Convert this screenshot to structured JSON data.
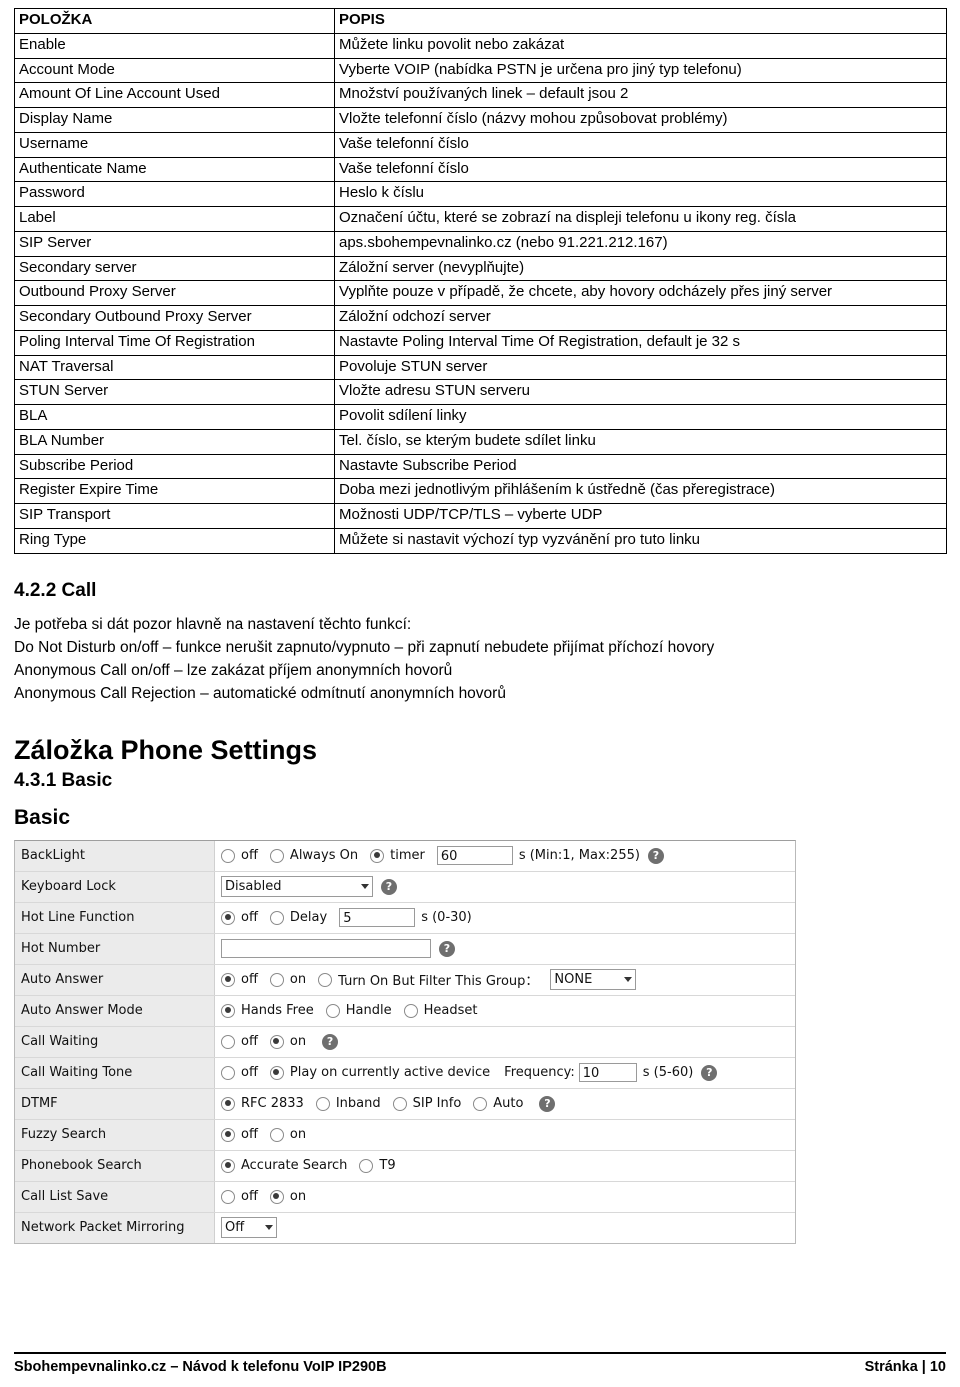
{
  "table": {
    "headers": [
      "POLOŽKA",
      "POPIS"
    ],
    "rows": [
      [
        "Enable",
        "Můžete linku povolit nebo zakázat"
      ],
      [
        "Account Mode",
        "Vyberte VOIP (nabídka PSTN je určena pro jiný typ telefonu)"
      ],
      [
        "Amount Of Line Account Used",
        "Množství používaných linek – default jsou 2"
      ],
      [
        "Display Name",
        "Vložte telefonní číslo (názvy mohou způsobovat problémy)"
      ],
      [
        "Username",
        "Vaše telefonní číslo"
      ],
      [
        "Authenticate Name",
        "Vaše telefonní číslo"
      ],
      [
        "Password",
        "Heslo k číslu"
      ],
      [
        "Label",
        "Označení účtu, které se zobrazí na displeji telefonu u ikony reg. čísla"
      ],
      [
        "SIP Server",
        "aps.sbohempevnalinko.cz  (nebo 91.221.212.167)"
      ],
      [
        "Secondary server",
        "Záložní server (nevyplňujte)"
      ],
      [
        "Outbound Proxy Server",
        "Vyplňte pouze v případě, že chcete, aby hovory odcházely přes jiný server"
      ],
      [
        "Secondary Outbound Proxy Server",
        "Záložní odchozí server"
      ],
      [
        "Poling Interval Time Of Registration",
        "Nastavte Poling Interval Time Of Registration, default je 32 s"
      ],
      [
        "NAT Traversal",
        "Povoluje STUN server"
      ],
      [
        "STUN Server",
        "Vložte adresu STUN serveru"
      ],
      [
        "BLA",
        "Povolit sdílení linky"
      ],
      [
        "BLA Number",
        "Tel. číslo, se kterým budete sdílet linku"
      ],
      [
        "Subscribe Period",
        "Nastavte Subscribe Period"
      ],
      [
        "Register Expire Time",
        "Doba mezi jednotlivým přihlášením k ústředně (čas přeregistrace)"
      ],
      [
        "SIP Transport",
        "Možnosti UDP/TCP/TLS – vyberte UDP"
      ],
      [
        "Ring Type",
        "Můžete si nastavit výchozí typ vyzvánění pro tuto linku"
      ]
    ]
  },
  "sections": {
    "call_heading": "4.2.2 Call",
    "call_intro": "Je potřeba si dát pozor hlavně na nastavení těchto funkcí:",
    "call_lines": [
      "Do Not Disturb on/off – funkce nerušit zapnuto/vypnuto – při zapnutí nebudete přijímat příchozí hovory",
      "Anonymous Call on/off – lze zakázat příjem anonymních hovorů",
      "Anonymous Call Rejection – automatické odmítnutí anonymních hovorů"
    ],
    "phone_settings_heading": "Záložka Phone Settings",
    "basic_heading": "4.3.1 Basic",
    "basic_title": "Basic"
  },
  "panel": {
    "backlight": {
      "label": "BackLight",
      "opt_off": "off",
      "opt_always": "Always On",
      "opt_timer": "timer",
      "timer_value": "60",
      "hint": "s (Min:1, Max:255)"
    },
    "keyboard_lock": {
      "label": "Keyboard Lock",
      "value": "Disabled"
    },
    "hot_line": {
      "label": "Hot Line Function",
      "opt_off": "off",
      "opt_delay": "Delay",
      "delay_value": "5",
      "hint": "s (0-30)"
    },
    "hot_number": {
      "label": "Hot Number",
      "value": ""
    },
    "auto_answer": {
      "label": "Auto Answer",
      "opt_off": "off",
      "opt_on": "on",
      "opt_filter": "Turn On But Filter This Group：",
      "group_value": "NONE"
    },
    "auto_answer_mode": {
      "label": "Auto Answer Mode",
      "opt_hands_free": "Hands Free",
      "opt_handle": "Handle",
      "opt_headset": "Headset"
    },
    "call_waiting": {
      "label": "Call Waiting",
      "opt_off": "off",
      "opt_on": "on"
    },
    "call_waiting_tone": {
      "label": "Call Waiting Tone",
      "opt_off": "off",
      "opt_play": "Play on currently active device",
      "freq_label": "Frequency:",
      "freq_value": "10",
      "hint": "s (5-60)"
    },
    "dtmf": {
      "label": "DTMF",
      "opt_rfc": "RFC 2833",
      "opt_inband": "Inband",
      "opt_sipinfo": "SIP Info",
      "opt_auto": "Auto"
    },
    "fuzzy_search": {
      "label": "Fuzzy Search",
      "opt_off": "off",
      "opt_on": "on"
    },
    "phonebook_search": {
      "label": "Phonebook Search",
      "opt_accurate": "Accurate Search",
      "opt_t9": "T9"
    },
    "call_list_save": {
      "label": "Call List Save",
      "opt_off": "off",
      "opt_on": "on"
    },
    "network_packet_mirroring": {
      "label": "Network Packet Mirroring",
      "value": "Off"
    },
    "help_glyph": "?"
  },
  "footer": {
    "left": "Sbohempevnalinko.cz – Návod k telefonu VoIP IP290B",
    "right": "Stránka | 10"
  }
}
